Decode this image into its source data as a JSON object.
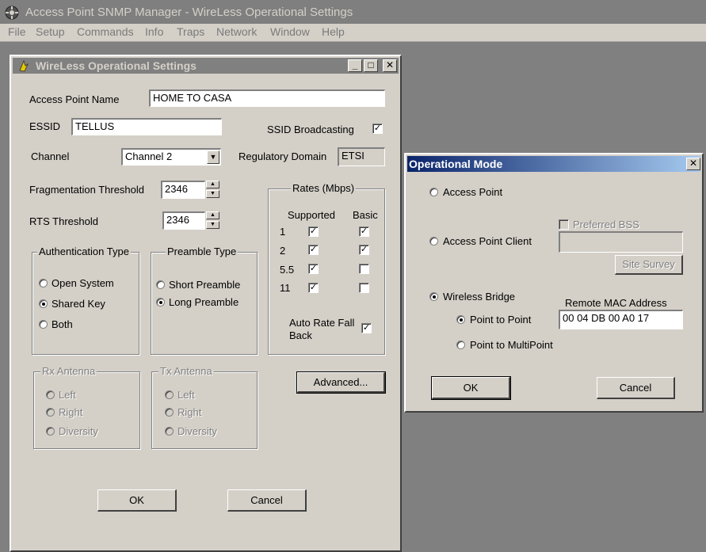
{
  "app": {
    "title": "Access Point SNMP Manager -  WireLess Operational Settings",
    "menu": [
      "File",
      "Setup",
      "Commands",
      "Info",
      "Traps",
      "Network",
      "Window",
      "Help"
    ]
  },
  "settings": {
    "title": "WireLess Operational Settings",
    "ap_name_label": "Access Point Name",
    "ap_name_value": "HOME TO CASA",
    "essid_label": "ESSID",
    "essid_value": "TELLUS",
    "ssid_broadcast_label": "SSID Broadcasting",
    "ssid_broadcast_checked": true,
    "channel_label": "Channel",
    "channel_value": "Channel 2",
    "reg_domain_label": "Regulatory Domain",
    "reg_domain_value": "ETSI",
    "frag_label": "Fragmentation Threshold",
    "frag_value": "2346",
    "rts_label": "RTS Threshold",
    "rts_value": "2346",
    "rates": {
      "title": "Rates (Mbps)",
      "supported_header": "Supported",
      "basic_header": "Basic",
      "rows": [
        {
          "rate": "1",
          "supported": true,
          "basic": true
        },
        {
          "rate": "2",
          "supported": true,
          "basic": true
        },
        {
          "rate": "5.5",
          "supported": true,
          "basic": false
        },
        {
          "rate": "11",
          "supported": true,
          "basic": false
        }
      ],
      "auto_fallback_label_1": "Auto Rate Fall",
      "auto_fallback_label_2": "Back",
      "auto_fallback_checked": true
    },
    "auth": {
      "title": "Authentication Type",
      "options": [
        "Open System",
        "Shared Key",
        "Both"
      ],
      "selected": "Shared Key"
    },
    "preamble": {
      "title": "Preamble Type",
      "options": [
        "Short Preamble",
        "Long Preamble"
      ],
      "selected": "Long Preamble"
    },
    "rx_antenna": {
      "title": "Rx Antenna",
      "options": [
        "Left",
        "Right",
        "Diversity"
      ]
    },
    "tx_antenna": {
      "title": "Tx Antenna",
      "options": [
        "Left",
        "Right",
        "Diversity"
      ]
    },
    "advanced_label": "Advanced...",
    "ok_label": "OK",
    "cancel_label": "Cancel"
  },
  "opmode": {
    "title": "Operational Mode",
    "access_point_label": "Access Point",
    "ap_client_label": "Access Point Client",
    "preferred_bss_label": "Preferred BSS",
    "site_survey_label": "Site Survey",
    "wireless_bridge_label": "Wireless Bridge",
    "remote_mac_label": "Remote MAC Address",
    "remote_mac_value": "00 04 DB 00 A0 17",
    "p2p_label": "Point to Point",
    "p2mp_label": "Point to MultiPoint",
    "selected_mode": "Wireless Bridge",
    "selected_bridge": "Point to Point",
    "ok_label": "OK",
    "cancel_label": "Cancel"
  }
}
